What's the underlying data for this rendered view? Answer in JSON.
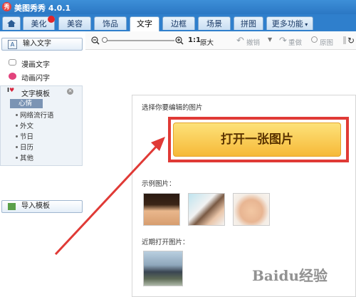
{
  "app": {
    "title": "美图秀秀 4.0.1",
    "logo_glyph": "秀"
  },
  "tabs": [
    {
      "label": "美化"
    },
    {
      "label": "美容"
    },
    {
      "label": "饰品"
    },
    {
      "label": "文字"
    },
    {
      "label": "边框"
    },
    {
      "label": "场景"
    },
    {
      "label": "拼图"
    },
    {
      "label": "更多功能"
    }
  ],
  "toolbar": {
    "ratio_label": "1:1",
    "original_size": "原大",
    "undo": "撤销",
    "redo": "重做",
    "original_image": "原图"
  },
  "sidebar": {
    "input_text": "输入文字",
    "comic_text": "漫画文字",
    "animated_text": "动画闪字",
    "text_template": "文字模板",
    "template_items": [
      "心情",
      "网络流行语",
      "外文",
      "节日",
      "日历",
      "其他"
    ],
    "import_template": "导入模板"
  },
  "main": {
    "prompt": "选择你要编辑的图片",
    "open_button": "打开一张图片",
    "examples_label": "示例图片：",
    "recent_label": "近期打开图片："
  },
  "watermark": "Baidu经验",
  "colors": {
    "accent_blue": "#2b77c4",
    "button_gold": "#f6b938",
    "highlight_red": "#e03a36"
  }
}
